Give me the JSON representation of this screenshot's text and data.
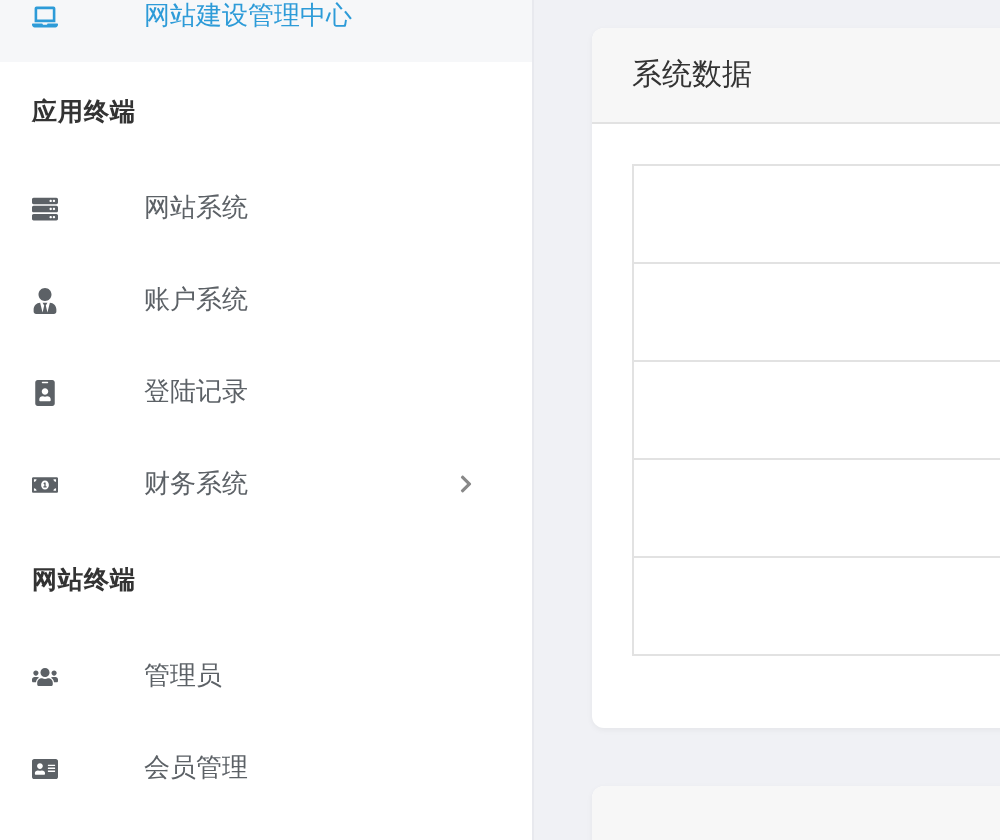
{
  "sidebar": {
    "items": [
      {
        "kind": "link",
        "label": "网站建设管理中心",
        "selected": true
      },
      {
        "kind": "heading",
        "label": "应用终端"
      },
      {
        "kind": "link",
        "label": "网站系统",
        "selected": false
      },
      {
        "kind": "link",
        "label": "账户系统",
        "selected": false
      },
      {
        "kind": "link",
        "label": "登陆记录",
        "selected": false
      },
      {
        "kind": "link",
        "label": "财务系统",
        "selected": false,
        "expandable": true
      },
      {
        "kind": "heading",
        "label": "网站终端"
      },
      {
        "kind": "link",
        "label": "管理员",
        "selected": false
      },
      {
        "kind": "link",
        "label": "会员管理",
        "selected": false
      }
    ]
  },
  "cards": [
    {
      "kind": "table",
      "title": "系统数据",
      "table": {
        "rows": [
          {
            "kind": "blank"
          },
          {
            "kind": "blank"
          },
          {
            "kind": "blank"
          },
          {
            "kind": "blank"
          },
          {
            "kind": "blank"
          }
        ]
      }
    },
    {
      "kind": "cut"
    }
  ]
}
